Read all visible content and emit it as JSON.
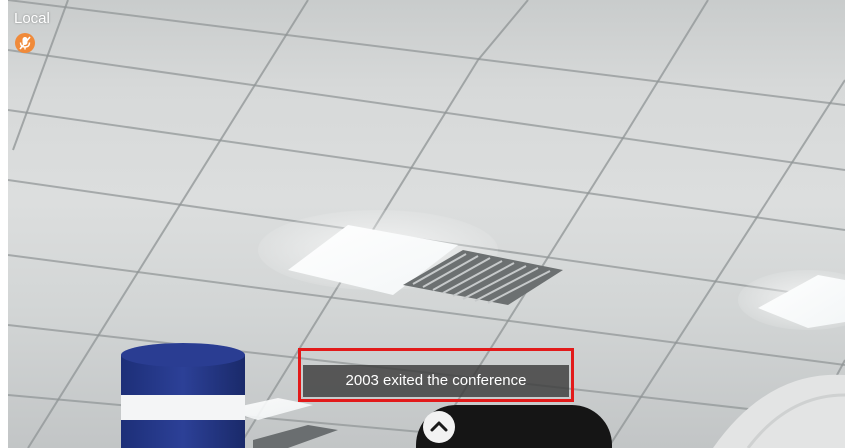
{
  "video": {
    "label": "Local",
    "mic_state_icon": "mic-off-icon",
    "accent_color": "#f08a3a"
  },
  "notification": {
    "message": "2003 exited the conference",
    "highlight_color": "#e21a1a"
  },
  "controls": {
    "expand_icon": "chevron-up-icon"
  }
}
